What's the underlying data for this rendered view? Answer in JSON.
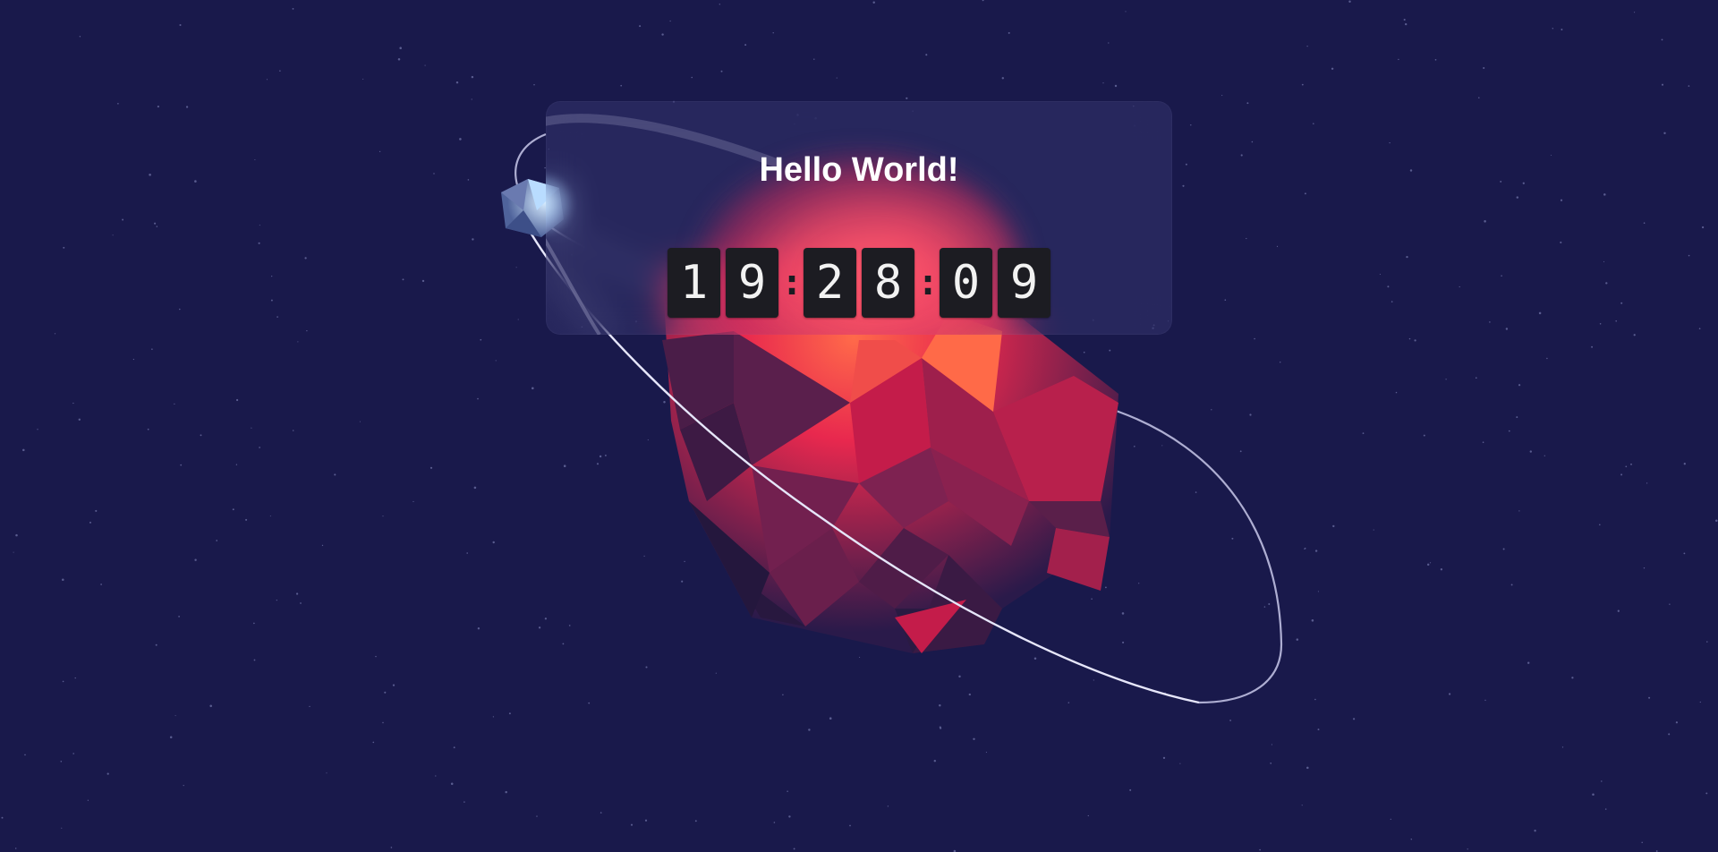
{
  "greeting": {
    "title": "Hello World!"
  },
  "clock": {
    "hours": [
      "1",
      "9"
    ],
    "minutes": [
      "2",
      "8"
    ],
    "seconds": [
      "0",
      "9"
    ],
    "separator": ":"
  },
  "colors": {
    "background": "#19194b",
    "planet_accent": "#e8284e",
    "moon": "#a9c8ff",
    "orbit_line": "#d8d8f4",
    "digit_tile": "#1c1c22",
    "digit_text": "#f2f2f2"
  },
  "icons": {
    "planet": "low-poly-planet-icon",
    "moon": "low-poly-moon-icon"
  }
}
